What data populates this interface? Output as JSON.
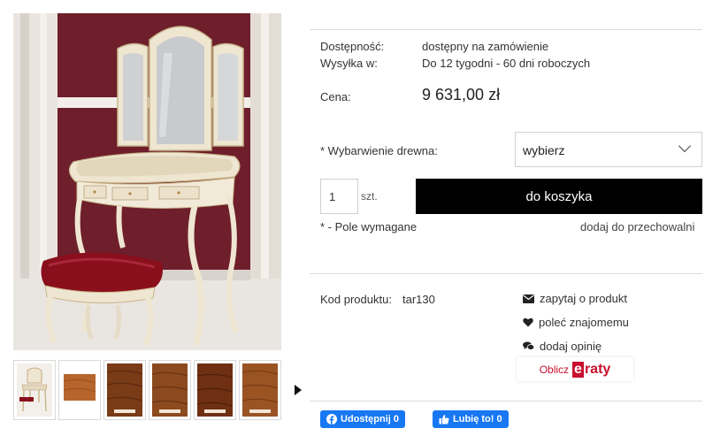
{
  "availability": {
    "label": "Dostępność:",
    "value": "dostępny na zamówienie"
  },
  "shipping": {
    "label": "Wysyłka w:",
    "value": "Do 12 tygodni - 60 dni roboczych"
  },
  "price": {
    "label": "Cena:",
    "value": "9 631,00 zł"
  },
  "wood_color": {
    "label": "* Wybarwienie drewna:",
    "selected": "wybierz"
  },
  "cart": {
    "quantity": "1",
    "unit": "szt.",
    "button_label": "do koszyka"
  },
  "required_note": "* - Pole wymagane",
  "store_link": "dodaj do przechowalni",
  "product_code": {
    "label": "Kod produktu:",
    "value": "tar130"
  },
  "actions": {
    "ask": "zapytaj o produkt",
    "recommend": "poleć znajomemu",
    "review": "dodaj opinię"
  },
  "installments": {
    "prefix": "Oblicz",
    "brand_e": "e",
    "brand_rest": "raty"
  },
  "social": {
    "share": "Udostępnij 0",
    "like": "Lubię to! 0"
  },
  "gallery": {
    "thumbnails": [
      "thumb-dressing-table",
      "thumb-wood-sample-1",
      "thumb-wood-sample-2",
      "thumb-wood-sample-3",
      "thumb-wood-sample-4",
      "thumb-wood-sample-5"
    ]
  },
  "colors": {
    "wall": "#6e1f2b",
    "furniture": "#efe6d2",
    "seat": "#8a0f1c",
    "accent": "#000000",
    "facebook": "#1877f2",
    "eraty": "#c8102e"
  }
}
